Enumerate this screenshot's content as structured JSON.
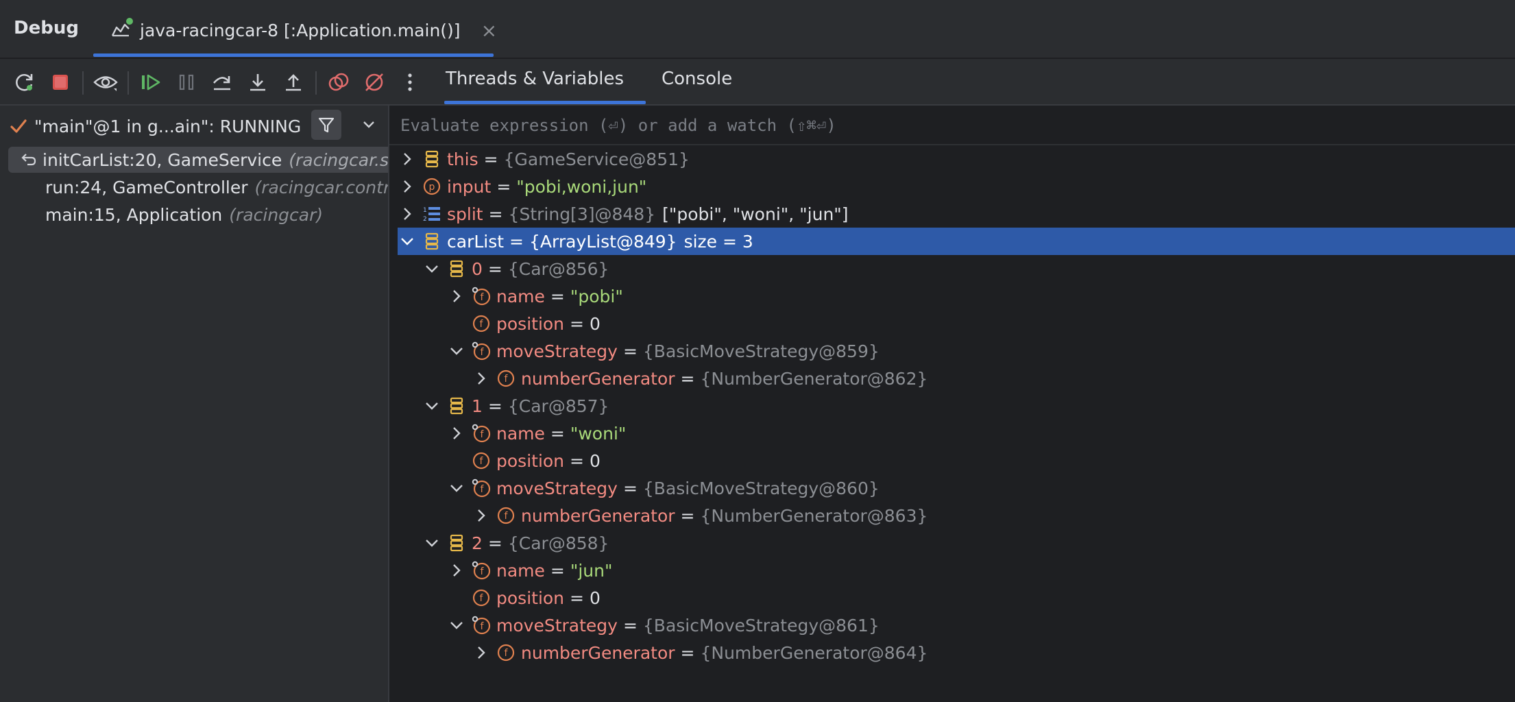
{
  "window": {
    "debug_label": "Debug",
    "session_title": "java-racingcar-8 [:Application.main()]",
    "close_glyph": "×"
  },
  "toolbar": {
    "icons": [
      "rerun-icon",
      "stop-icon",
      "view-breakpoints-icon",
      "resume-icon",
      "pause-icon",
      "step-over-icon",
      "step-into-icon",
      "step-out-icon",
      "view-breakpoints-red-icon",
      "mute-breakpoints-icon",
      "more-icon"
    ]
  },
  "tabs": {
    "threads": "Threads & Variables",
    "console": "Console"
  },
  "thread": {
    "label": "\"main\"@1 in g...ain\": RUNNING"
  },
  "frames": [
    {
      "fn": "initCarList:20, GameService",
      "pkg": "(racingcar.se"
    },
    {
      "fn": "run:24, GameController",
      "pkg": "(racingcar.contro"
    },
    {
      "fn": "main:15, Application",
      "pkg": "(racingcar)"
    }
  ],
  "evaluate": {
    "placeholder": "Evaluate expression (⏎) or add a watch (⇧⌘⏎)"
  },
  "variables": [
    {
      "name": "this",
      "eq": "=",
      "value": "{GameService@851}",
      "extra": ""
    },
    {
      "name": "input",
      "eq": "=",
      "value": "\"pobi,woni,jun\"",
      "extra": ""
    },
    {
      "name": "split",
      "eq": "=",
      "value": "{String[3]@848}",
      "extra": "[\"pobi\", \"woni\", \"jun\"]"
    },
    {
      "name": "carList",
      "eq": "=",
      "value": "{ArrayList@849}",
      "extra": "size = 3"
    },
    {
      "name": "0",
      "eq": "=",
      "value": "{Car@856}",
      "extra": ""
    },
    {
      "name": "name",
      "eq": "=",
      "value": "\"pobi\"",
      "extra": ""
    },
    {
      "name": "position",
      "eq": "=",
      "value": "0",
      "extra": ""
    },
    {
      "name": "moveStrategy",
      "eq": "=",
      "value": "{BasicMoveStrategy@859}",
      "extra": ""
    },
    {
      "name": "numberGenerator",
      "eq": "=",
      "value": "{NumberGenerator@862}",
      "extra": ""
    },
    {
      "name": "1",
      "eq": "=",
      "value": "{Car@857}",
      "extra": ""
    },
    {
      "name": "name",
      "eq": "=",
      "value": "\"woni\"",
      "extra": ""
    },
    {
      "name": "position",
      "eq": "=",
      "value": "0",
      "extra": ""
    },
    {
      "name": "moveStrategy",
      "eq": "=",
      "value": "{BasicMoveStrategy@860}",
      "extra": ""
    },
    {
      "name": "numberGenerator",
      "eq": "=",
      "value": "{NumberGenerator@863}",
      "extra": ""
    },
    {
      "name": "2",
      "eq": "=",
      "value": "{Car@858}",
      "extra": ""
    },
    {
      "name": "name",
      "eq": "=",
      "value": "\"jun\"",
      "extra": ""
    },
    {
      "name": "position",
      "eq": "=",
      "value": "0",
      "extra": ""
    },
    {
      "name": "moveStrategy",
      "eq": "=",
      "value": "{BasicMoveStrategy@861}",
      "extra": ""
    },
    {
      "name": "numberGenerator",
      "eq": "=",
      "value": "{NumberGenerator@864}",
      "extra": ""
    }
  ],
  "colors": {
    "accent": "#3d74d8",
    "selection": "#2e5aa8",
    "field_icon": "#e0814f",
    "object_icon": "#e6b84a",
    "var_name": "#f28b82",
    "string_value": "#a9d97a"
  }
}
